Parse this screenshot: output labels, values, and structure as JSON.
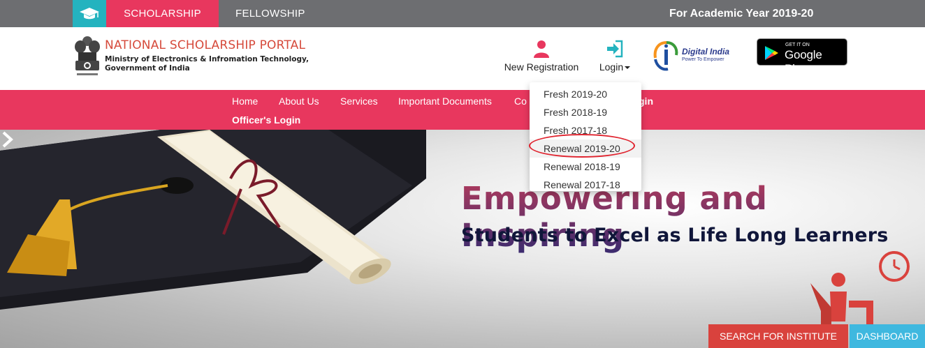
{
  "topbar": {
    "cap_icon": "graduation-cap-icon",
    "tab_scholarship": "SCHOLARSHIP",
    "tab_fellowship": "FELLOWSHIP",
    "academic_year": "For Academic Year 2019-20"
  },
  "header": {
    "title": "NATIONAL SCHOLARSHIP PORTAL",
    "subtitle_1": "Ministry of Electronics & Infromation Technology,",
    "subtitle_2": "Government of India",
    "new_registration": "New Registration",
    "login": "Login",
    "digital_india_title": "Digital India",
    "digital_india_sub": "Power To Empower",
    "google_play_small": "GET IT ON",
    "google_play_big": "Google Play"
  },
  "nav": {
    "items": [
      "Home",
      "About Us",
      "Services",
      "Important Documents",
      "Co",
      "gin"
    ],
    "officer_login": "Officer's Login"
  },
  "login_dropdown": {
    "items": [
      "Fresh 2019-20",
      "Fresh 2018-19",
      "Fresh 2017-18",
      "Renewal 2019-20",
      "Renewal 2018-19",
      "Renewal 2017-18"
    ],
    "highlighted": "Renewal 2019-20"
  },
  "hero": {
    "heading": "Empowering and Inspiring",
    "subheading": "Students to Excel as Life Long Learners"
  },
  "buttons": {
    "search_institute": "SEARCH FOR INSTITUTE",
    "dashboard": "DASHBOARD"
  },
  "colors": {
    "accent_pink": "#e8375e",
    "teal": "#24b3bf",
    "topbar_grey": "#6d6e71",
    "search_red": "#d9423d",
    "dashboard_blue": "#3fb8df"
  }
}
